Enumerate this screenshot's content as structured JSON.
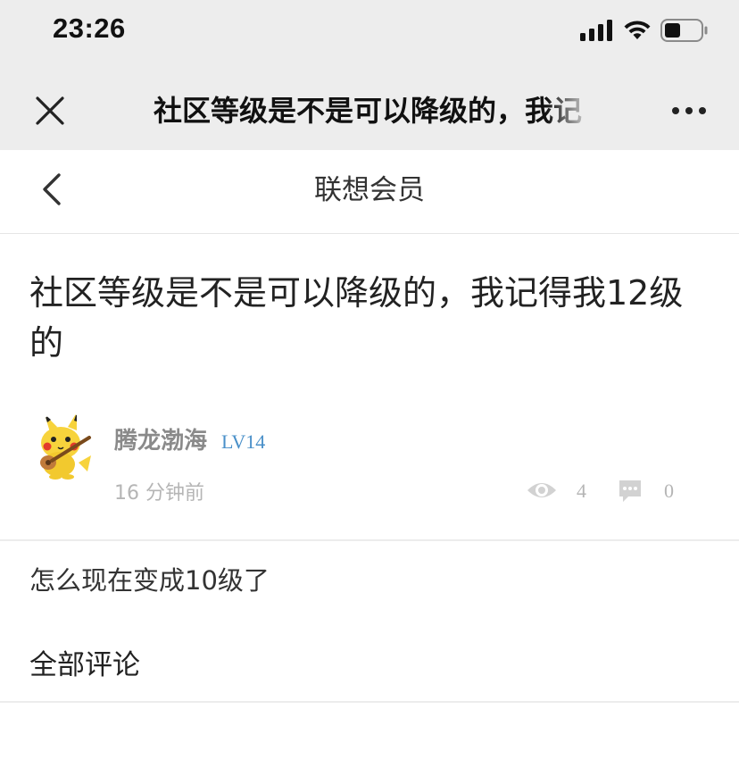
{
  "status_bar": {
    "time": "23:26",
    "icons": [
      "signal-icon",
      "wifi-icon",
      "battery-icon"
    ]
  },
  "webview_bar": {
    "title": "社区等级是不是可以降级的，我记",
    "icons": [
      "close-icon",
      "more-icon"
    ]
  },
  "nav": {
    "title": "联想会员",
    "icons": [
      "back-chevron-icon"
    ]
  },
  "post": {
    "title": "社区等级是不是可以降级的，我记得我12级的",
    "author": "腾龙渤海",
    "level": "LV14",
    "time": "16 分钟前",
    "views": "4",
    "comments": "0",
    "content": "怎么现在变成10级了"
  },
  "comments_section": {
    "title": "全部评论"
  },
  "colors": {
    "top_bar_bg": "#ededed",
    "level_blue": "#4a90c9",
    "meta_gray": "#b5b5b5"
  }
}
